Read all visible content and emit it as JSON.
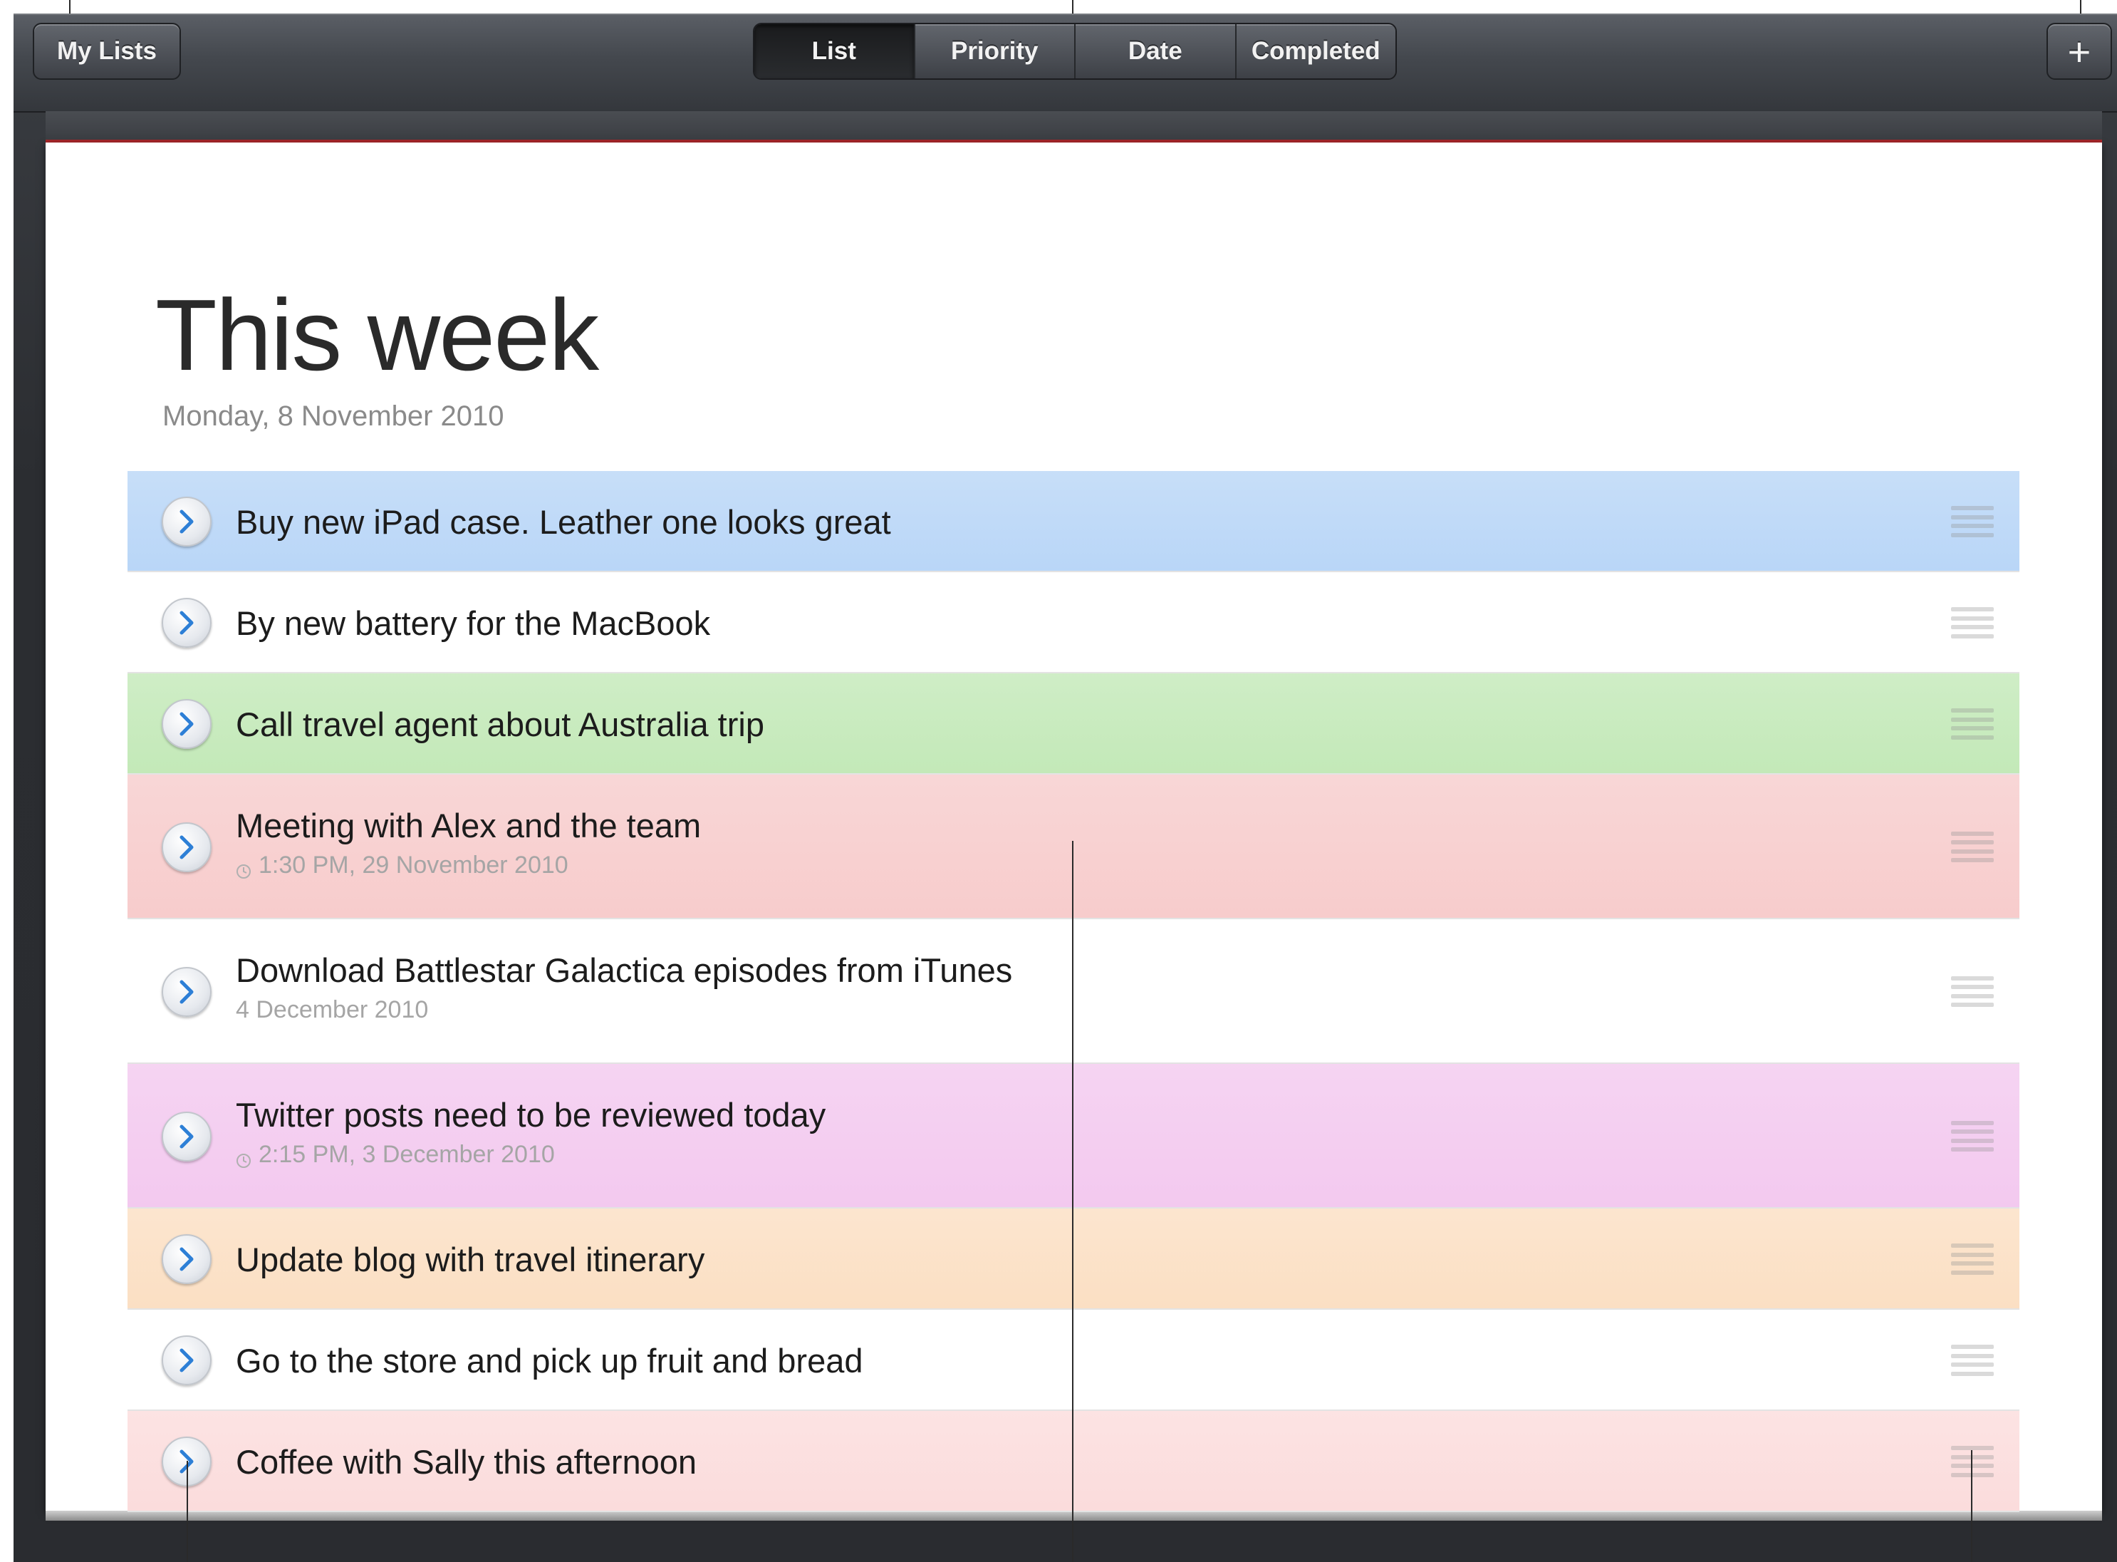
{
  "toolbar": {
    "my_lists_label": "My Lists",
    "add_label": "+",
    "segments": [
      {
        "label": "List",
        "active": true
      },
      {
        "label": "Priority",
        "active": false
      },
      {
        "label": "Date",
        "active": false
      },
      {
        "label": "Completed",
        "active": false
      }
    ]
  },
  "page": {
    "title": "This week",
    "date": "Monday, 8 November 2010"
  },
  "tasks": [
    {
      "title": "Buy new iPad case. Leather one looks great",
      "subtitle": "",
      "has_clock": false,
      "color": "#b9d6f7"
    },
    {
      "title": "By new battery for the MacBook",
      "subtitle": "",
      "has_clock": false,
      "color": "#ffffff"
    },
    {
      "title": "Call travel agent about Australia trip",
      "subtitle": "",
      "has_clock": false,
      "color": "#c3e9b8"
    },
    {
      "title": "Meeting with Alex and the team",
      "subtitle": "1:30 PM, 29 November 2010",
      "has_clock": true,
      "color": "#f7cccc"
    },
    {
      "title": "Download Battlestar Galactica episodes from iTunes",
      "subtitle": "4 December 2010",
      "has_clock": false,
      "color": "#ffffff"
    },
    {
      "title": "Twitter posts need to be reviewed today",
      "subtitle": "2:15 PM, 3 December 2010",
      "has_clock": true,
      "color": "#f3c9ef"
    },
    {
      "title": "Update blog with travel itinerary",
      "subtitle": "",
      "has_clock": false,
      "color": "#fbdfc3"
    },
    {
      "title": "Go to the store and pick up fruit and bread",
      "subtitle": "",
      "has_clock": false,
      "color": "#ffffff"
    },
    {
      "title": "Coffee with Sally this afternoon",
      "subtitle": "",
      "has_clock": false,
      "color": "#fbdcdc"
    }
  ],
  "icons": {
    "disclosure": "chevron-right-icon",
    "grip": "reorder-grip-icon",
    "clock": "clock-icon"
  }
}
